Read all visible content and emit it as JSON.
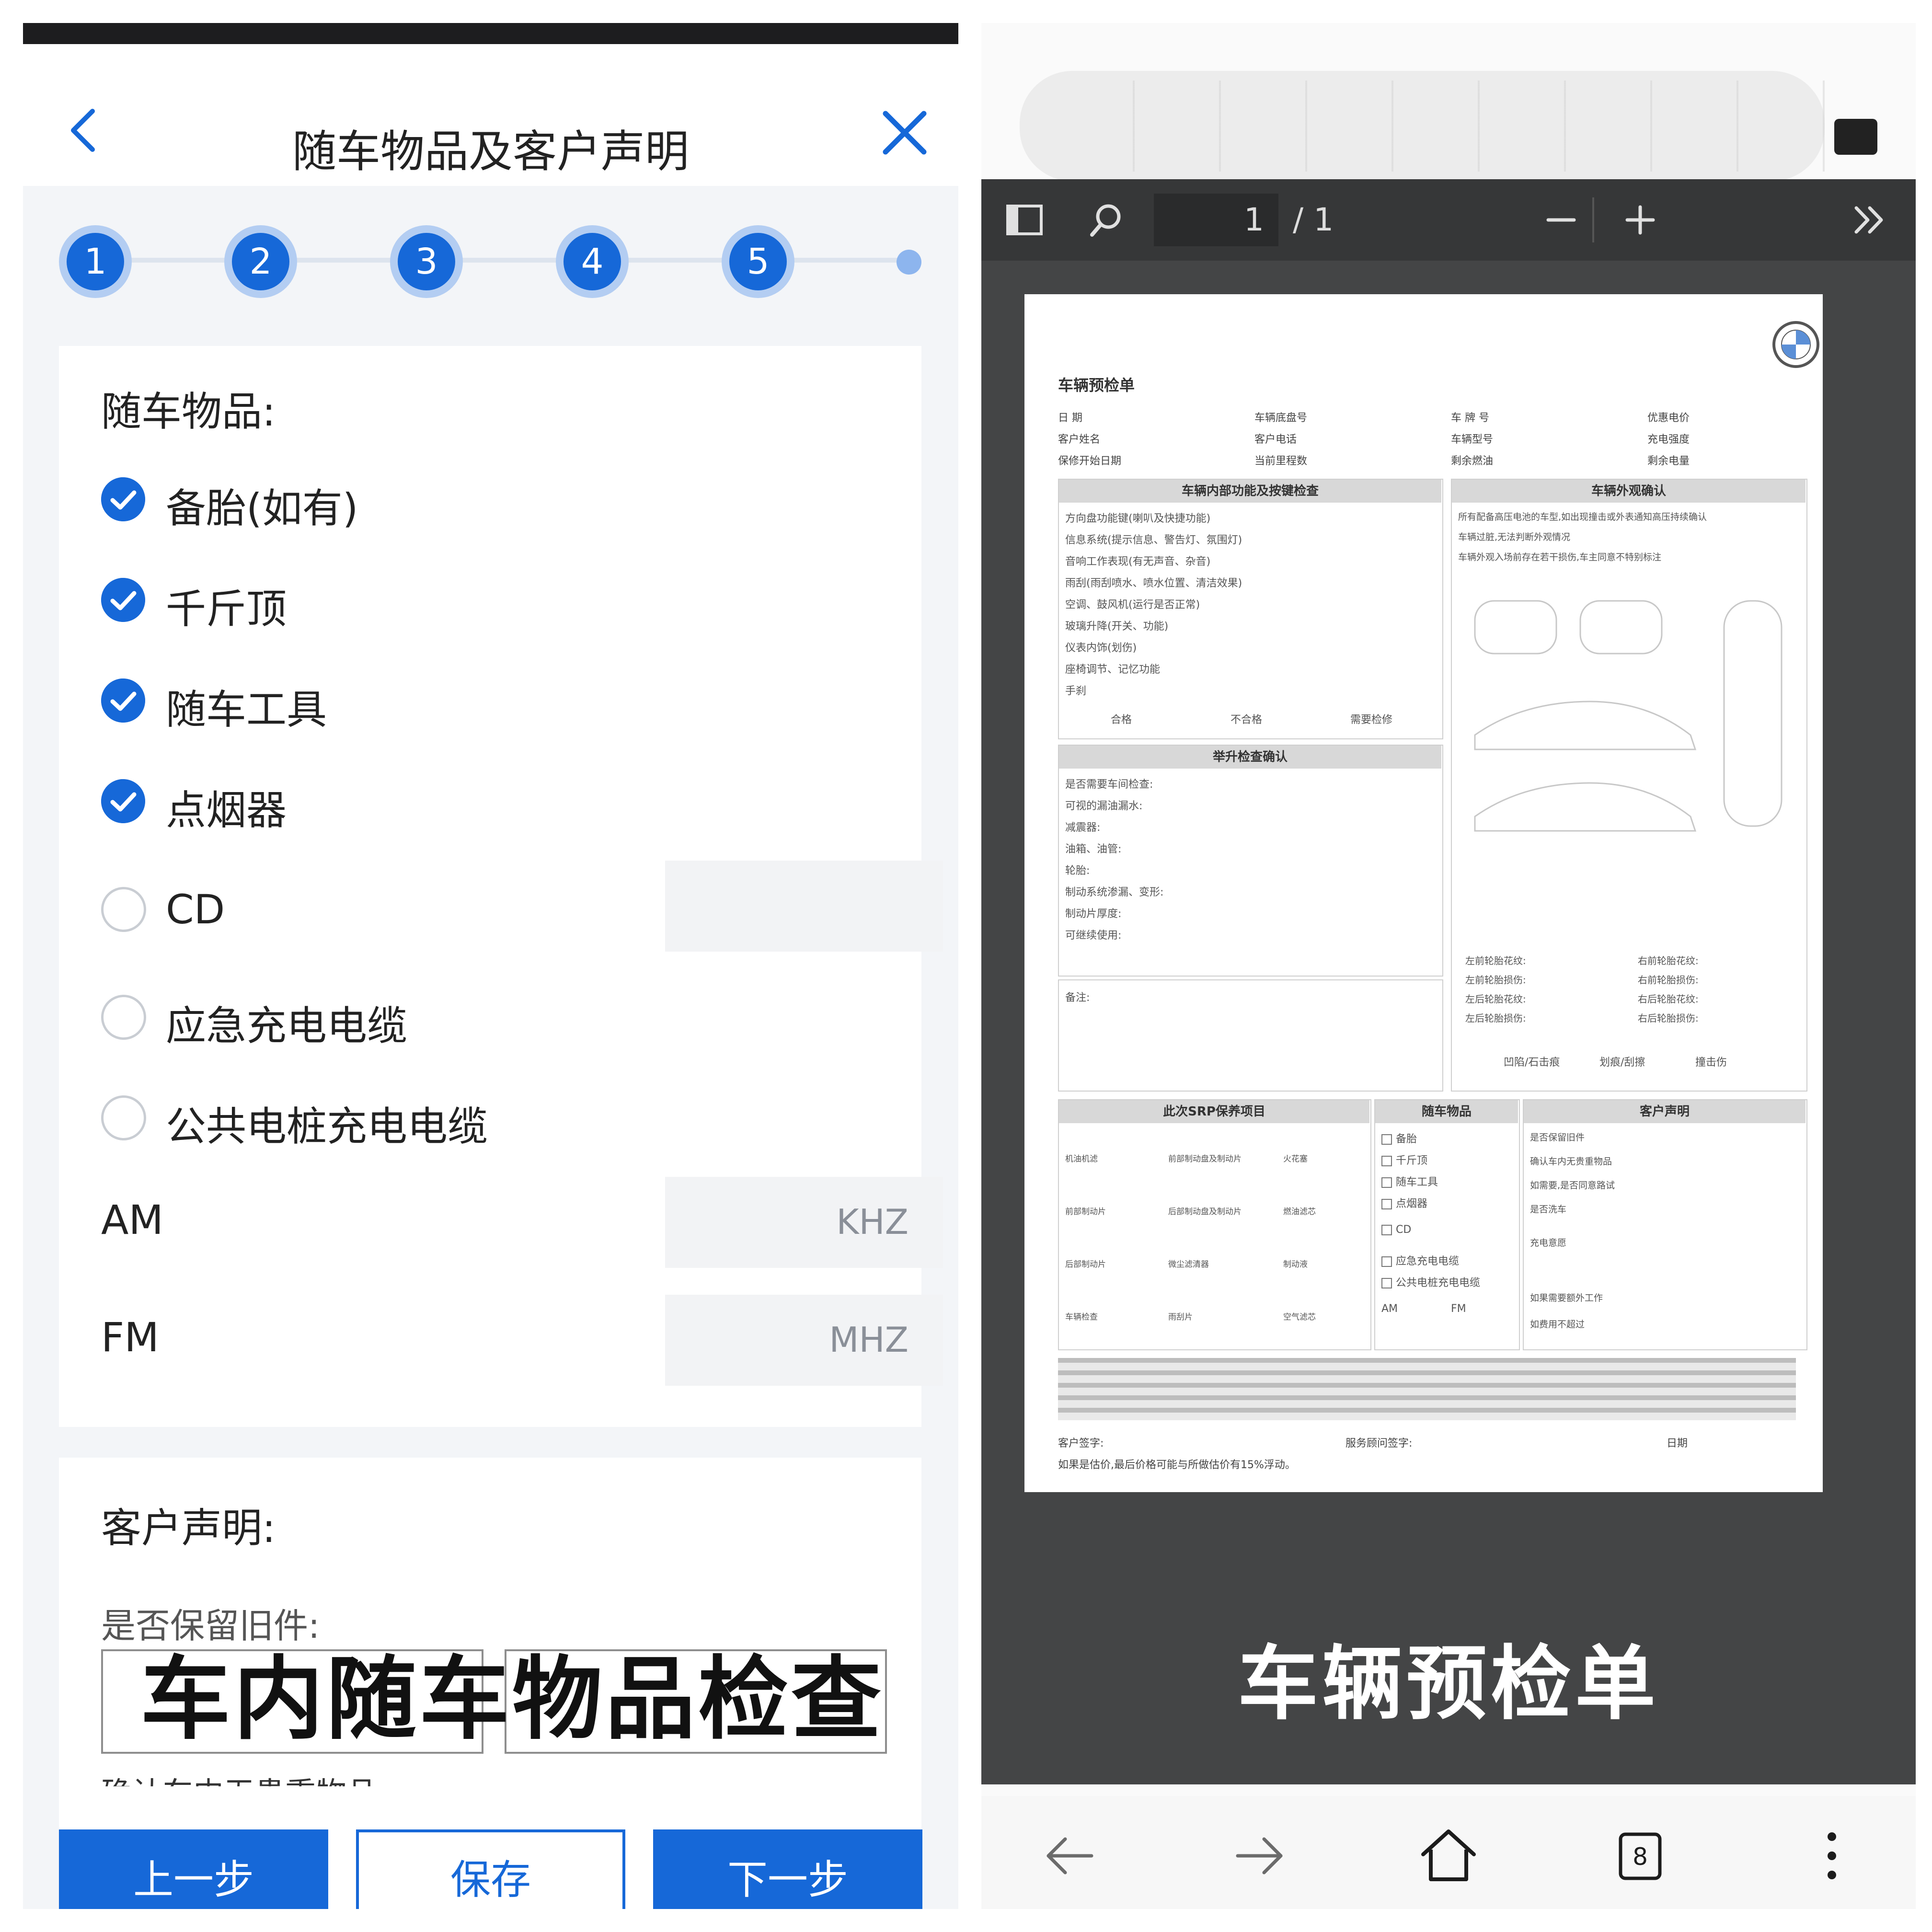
{
  "left": {
    "nav": {
      "title": "随车物品及客户声明"
    },
    "steps": [
      "1",
      "2",
      "3",
      "4",
      "5"
    ],
    "items_section": {
      "title": "随车物品:",
      "checked": [
        "备胎(如有)",
        "千斤顶",
        "随车工具",
        "点烟器"
      ],
      "unchecked": [
        "CD",
        "应急充电电缆",
        "公共电桩充电电缆"
      ],
      "am": {
        "label": "AM",
        "unit": "KHZ"
      },
      "fm": {
        "label": "FM",
        "unit": "MHZ"
      }
    },
    "declaration": {
      "title": "客户声明:",
      "question": "是否保留旧件:",
      "overlay": "车内随车物品检查",
      "cut_text": "确认车内无贵重物品:"
    },
    "buttons": {
      "prev": "上一步",
      "save": "保存",
      "next": "下一步"
    }
  },
  "right": {
    "viewer": {
      "page_current": "1",
      "page_total": "/ 1"
    },
    "nav": {
      "tabs_count": "8"
    },
    "sheet": {
      "doc_title": "车辆预检单",
      "header_fields": [
        "日 期",
        "客户姓名",
        "保修开始日期",
        "车辆底盘号",
        "客户电话",
        "当前里程数",
        "车 牌 号",
        "车辆型号",
        "剩余燃油",
        "优惠电价",
        "充电强度",
        "剩余电量"
      ],
      "sections": {
        "interior": "车辆内部功能及按键检查",
        "exterior": "车辆外观确认",
        "lift": "举升检查确认",
        "srp": "此次SRP保养项目",
        "items": "随车物品",
        "declaration": "客户声明"
      },
      "interior_items": [
        "方向盘功能键(喇叭及快捷功能)",
        "信息系统(提示信息、警告灯、氛围灯)",
        "音响工作表现(有无声音、杂音)",
        "雨刮(雨刮喷水、喷水位置、清洁效果)",
        "空调、鼓风机(运行是否正常)",
        "玻璃升降(开关、功能)",
        "仪表内饰(划伤)",
        "座椅调节、记忆功能",
        "手刹"
      ],
      "interior_legend": [
        "合格",
        "不合格",
        "需要检修"
      ],
      "lift_items": [
        "是否需要车间检查:",
        "可视的漏油漏水:",
        "减震器:",
        "油箱、油管:",
        "轮胎:",
        "制动系统渗漏、变形:",
        "制动片厚度:",
        "可继续使用:"
      ],
      "exterior_notes": [
        "所有配备高压电池的车型,如出现撞击或外表通知高压持续确认",
        "车辆过脏,无法判断外观情况",
        "车辆外观入场前存在若干损伤,车主同意不特别标注"
      ],
      "tire_labels": [
        "左前轮胎花纹:",
        "左前轮胎损伤:",
        "左后轮胎花纹:",
        "左后轮胎损伤:",
        "右前轮胎花纹:",
        "右前轮胎损伤:",
        "右后轮胎花纹:",
        "右后轮胎损伤:"
      ],
      "damage_legend": [
        "凹陷/石击痕",
        "划痕/刮擦",
        "撞击伤"
      ],
      "srp_items": [
        "机油机滤",
        "前部制动盘及制动片",
        "火花塞",
        "前部制动片",
        "后部制动盘及制动片",
        "燃油滤芯",
        "后部制动片",
        "微尘滤清器",
        "制动液",
        "车辆检查",
        "雨刮片",
        "空气滤芯"
      ],
      "item_list": [
        "备胎",
        "千斤顶",
        "随车工具",
        "点烟器",
        "CD",
        "应急充电电缆",
        "公共电桩充电电缆",
        "AM",
        "FM"
      ],
      "declaration_items": [
        "是否保留旧件",
        "确认车内无贵重物品",
        "如需要,是否同意路试",
        "是否洗车",
        "充电意愿",
        "如果需要额外工作",
        "如费用不超过"
      ],
      "remark_label": "备注:",
      "signature": {
        "customer": "客户签字:",
        "advisor": "服务顾问签字:",
        "date": "日期",
        "note": "如果是估价,最后价格可能与所做估价有15%浮动。"
      }
    },
    "caption": "车辆预检单"
  },
  "colors": {
    "primary": "#1668d8",
    "step_ring": "#b3cdf2",
    "viewer_bg": "#444546",
    "toolbar_bg": "#363738"
  },
  "icons": {
    "left": [
      "back-chevron-icon",
      "close-x-icon",
      "check-circle-icon",
      "radio-empty-icon"
    ],
    "right": [
      "sidebar-toggle-icon",
      "search-icon",
      "zoom-out-icon",
      "zoom-in-icon",
      "more-tools-icon",
      "bmw-logo-icon",
      "back-arrow-icon",
      "forward-arrow-icon",
      "home-icon",
      "tabs-icon",
      "menu-dots-icon"
    ]
  }
}
